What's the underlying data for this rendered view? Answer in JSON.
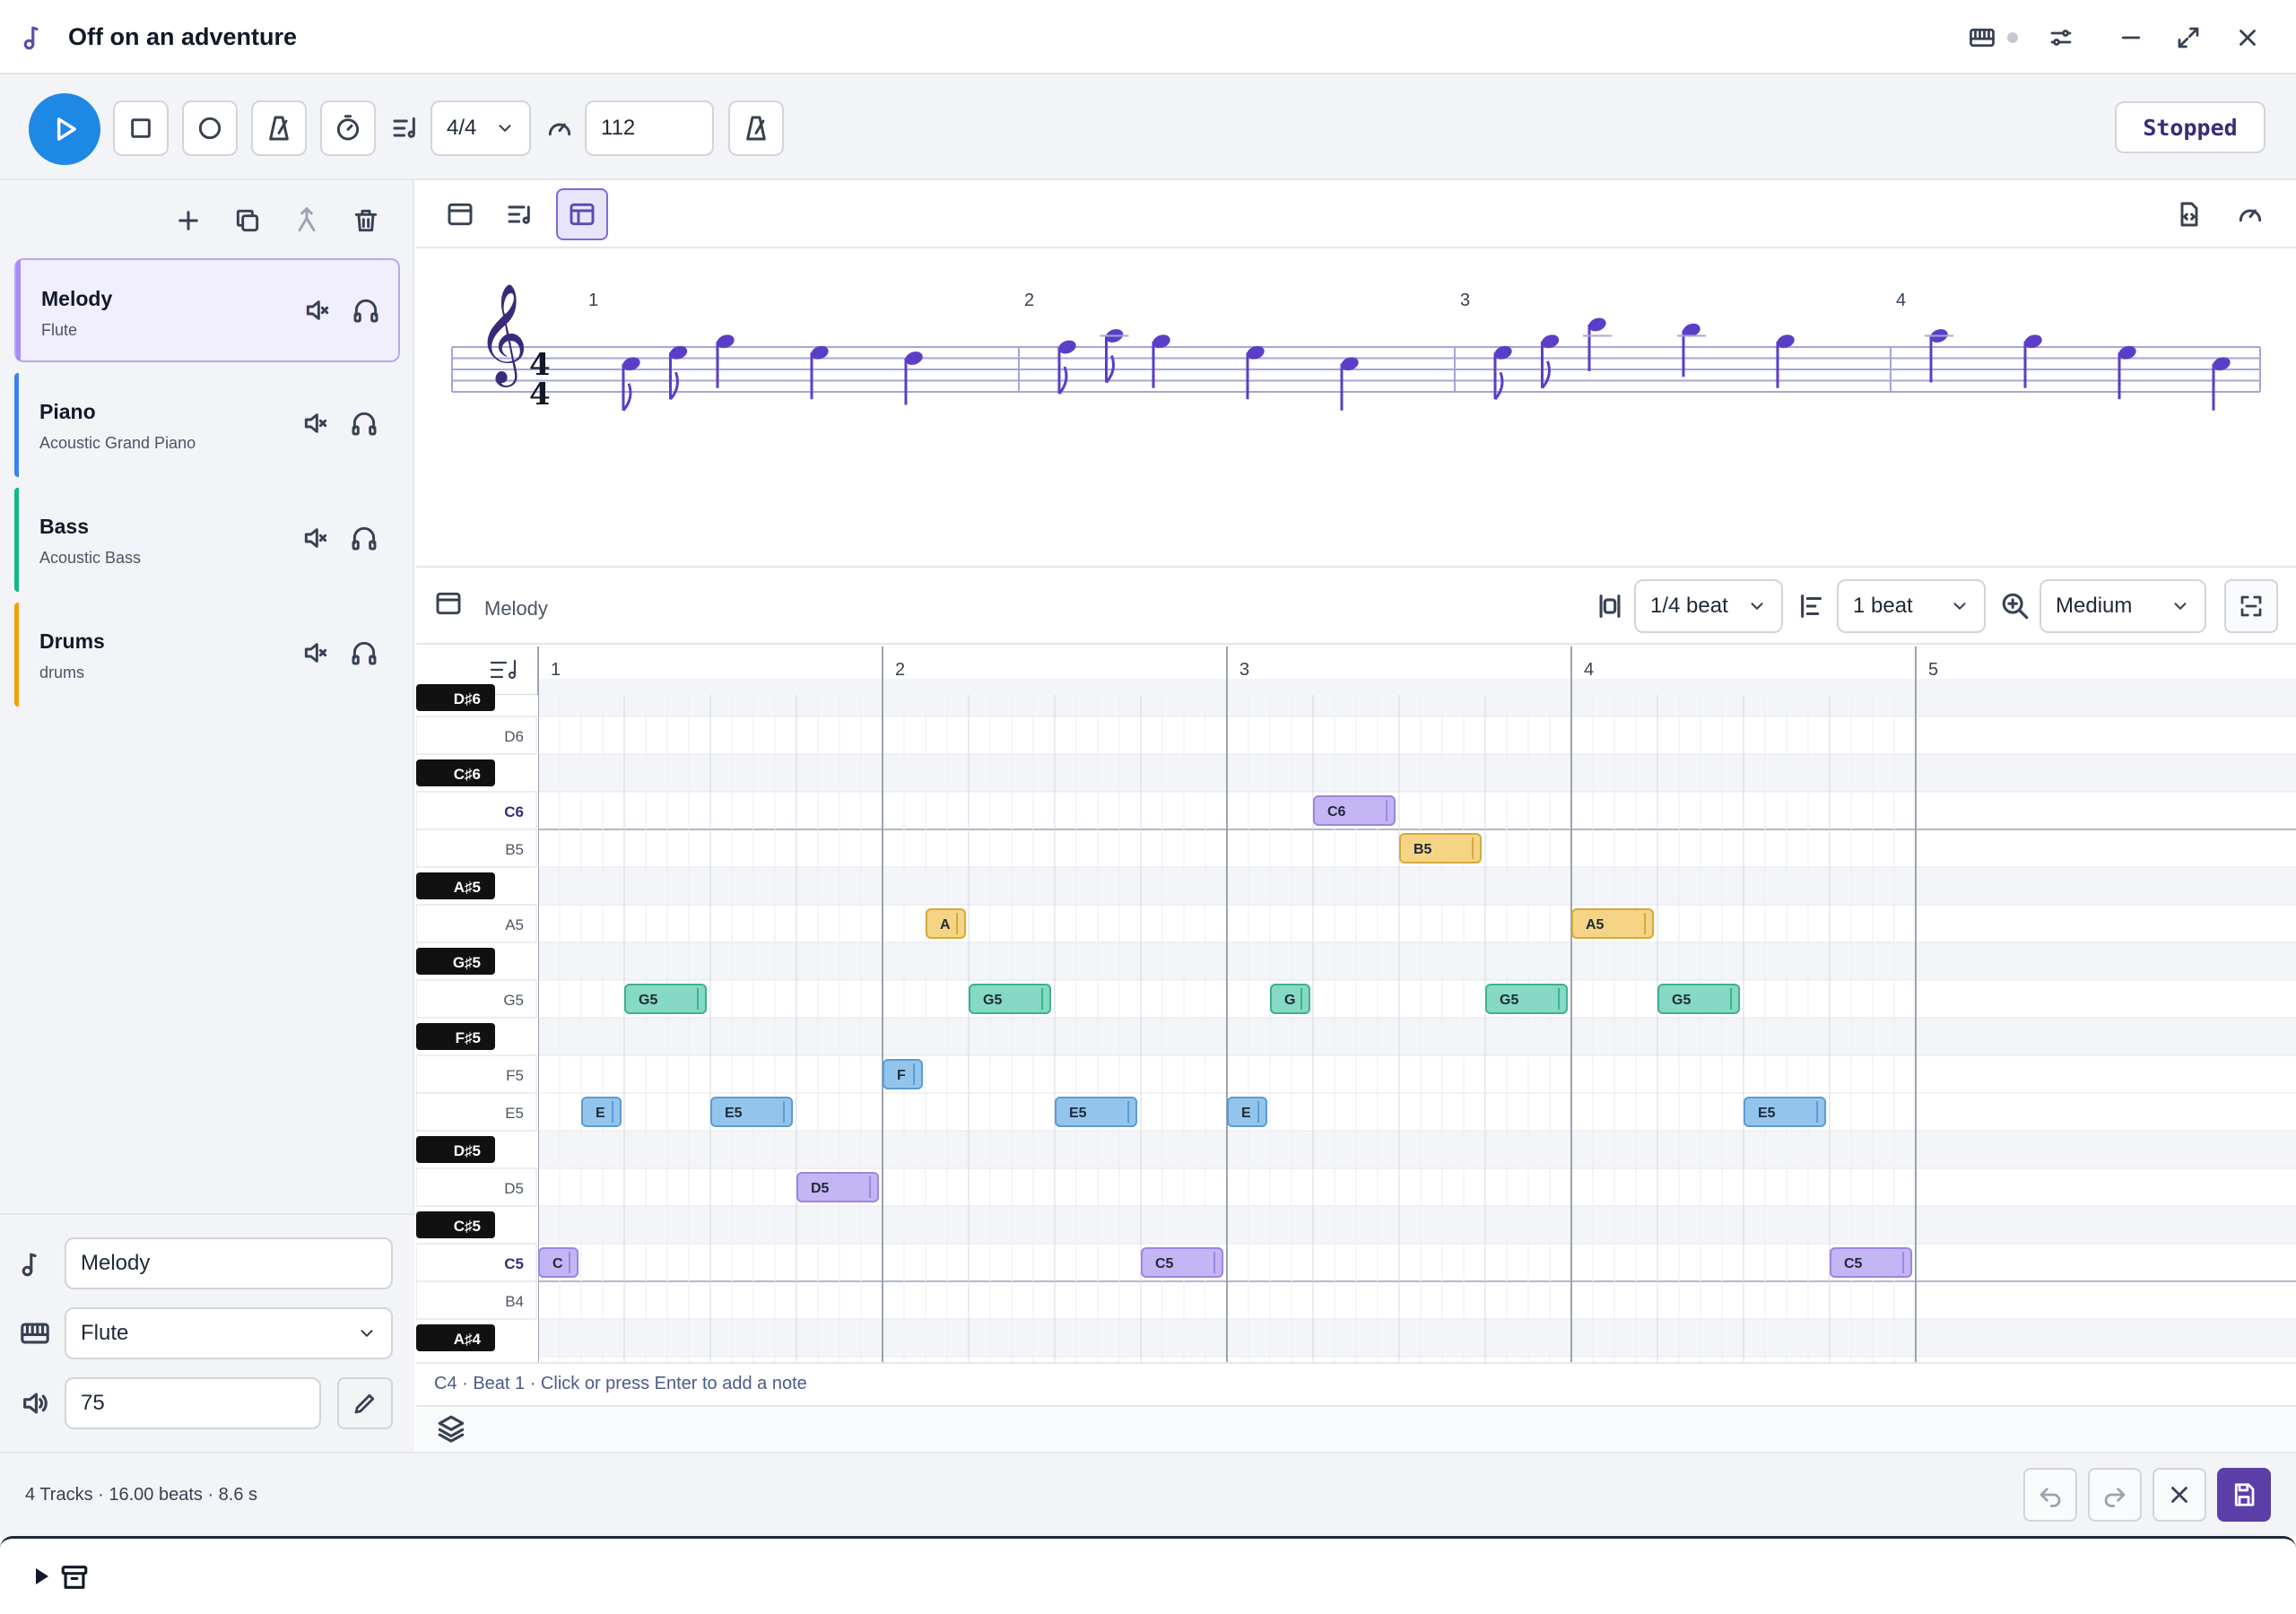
{
  "window": {
    "title": "Off on an adventure"
  },
  "toolbar": {
    "time_signature": "4/4",
    "tempo": "112",
    "status": "Stopped"
  },
  "tracks": [
    {
      "name": "Melody",
      "instrument": "Flute",
      "color": "#a78bfa",
      "selected": true
    },
    {
      "name": "Piano",
      "instrument": "Acoustic Grand Piano",
      "color": "#3b82f6"
    },
    {
      "name": "Bass",
      "instrument": "Acoustic Bass",
      "color": "#10b981"
    },
    {
      "name": "Drums",
      "instrument": "drums",
      "color": "#f59e0b"
    }
  ],
  "properties": {
    "track_name": "Melody",
    "instrument": "Flute",
    "volume": "75"
  },
  "score": {
    "time_signature_top": "4",
    "time_signature_bottom": "4",
    "measures": [
      "1",
      "2",
      "3",
      "4"
    ]
  },
  "roll": {
    "track_label": "Melody",
    "snap": "1/4 beat",
    "note_length": "1 beat",
    "zoom": "Medium",
    "beat_labels": [
      "1",
      "2",
      "3",
      "4",
      "5"
    ],
    "keys": [
      {
        "label": "D♯6",
        "black": true
      },
      {
        "label": "D6",
        "black": false
      },
      {
        "label": "C♯6",
        "black": true
      },
      {
        "label": "C6",
        "black": false
      },
      {
        "label": "B5",
        "black": false
      },
      {
        "label": "A♯5",
        "black": true
      },
      {
        "label": "A5",
        "black": false
      },
      {
        "label": "G♯5",
        "black": true
      },
      {
        "label": "G5",
        "black": false
      },
      {
        "label": "F♯5",
        "black": true
      },
      {
        "label": "F5",
        "black": false
      },
      {
        "label": "E5",
        "black": false
      },
      {
        "label": "D♯5",
        "black": true
      },
      {
        "label": "D5",
        "black": false
      },
      {
        "label": "C♯5",
        "black": true
      },
      {
        "label": "C5",
        "black": false
      },
      {
        "label": "B4",
        "black": false
      },
      {
        "label": "A♯4",
        "black": true
      }
    ],
    "notes": [
      {
        "label": "C",
        "pitch": "C5",
        "start": 0.0,
        "length": 0.25,
        "color": "purple"
      },
      {
        "label": "E",
        "pitch": "E5",
        "start": 0.25,
        "length": 0.25,
        "color": "blue"
      },
      {
        "label": "G5",
        "pitch": "G5",
        "start": 0.5,
        "length": 0.5,
        "color": "green"
      },
      {
        "label": "E5",
        "pitch": "E5",
        "start": 1.0,
        "length": 0.5,
        "color": "blue"
      },
      {
        "label": "D5",
        "pitch": "D5",
        "start": 1.5,
        "length": 0.5,
        "color": "purple"
      },
      {
        "label": "F",
        "pitch": "F5",
        "start": 2.0,
        "length": 0.25,
        "color": "blue"
      },
      {
        "label": "A",
        "pitch": "A5",
        "start": 2.25,
        "length": 0.25,
        "color": "yellow"
      },
      {
        "label": "G5",
        "pitch": "G5",
        "start": 2.5,
        "length": 0.5,
        "color": "green"
      },
      {
        "label": "E5",
        "pitch": "E5",
        "start": 3.0,
        "length": 0.5,
        "color": "blue"
      },
      {
        "label": "C5",
        "pitch": "C5",
        "start": 3.5,
        "length": 0.5,
        "color": "purple"
      },
      {
        "label": "E",
        "pitch": "E5",
        "start": 4.0,
        "length": 0.25,
        "color": "blue"
      },
      {
        "label": "G",
        "pitch": "G5",
        "start": 4.25,
        "length": 0.25,
        "color": "green"
      },
      {
        "label": "C6",
        "pitch": "C6",
        "start": 4.5,
        "length": 0.5,
        "color": "purple"
      },
      {
        "label": "B5",
        "pitch": "B5",
        "start": 5.0,
        "length": 0.5,
        "color": "yellow"
      },
      {
        "label": "G5",
        "pitch": "G5",
        "start": 5.5,
        "length": 0.5,
        "color": "green"
      },
      {
        "label": "A5",
        "pitch": "A5",
        "start": 6.0,
        "length": 0.5,
        "color": "yellow"
      },
      {
        "label": "G5",
        "pitch": "G5",
        "start": 6.5,
        "length": 0.5,
        "color": "green"
      },
      {
        "label": "E5",
        "pitch": "E5",
        "start": 7.0,
        "length": 0.5,
        "color": "blue"
      },
      {
        "label": "C5",
        "pitch": "C5",
        "start": 7.5,
        "length": 0.5,
        "color": "purple"
      }
    ],
    "hint": "C4 · Beat 1 · Click or press Enter to add a note"
  },
  "footer": {
    "info": "4 Tracks · 16.00 beats · 8.6 s"
  },
  "colors": {
    "accent": "#1e88e5",
    "note_purple": "#c4b5f4",
    "note_blue": "#93c5ec",
    "note_green": "#86d9c2",
    "note_yellow": "#f5d585",
    "save": "#5b3ea8"
  }
}
